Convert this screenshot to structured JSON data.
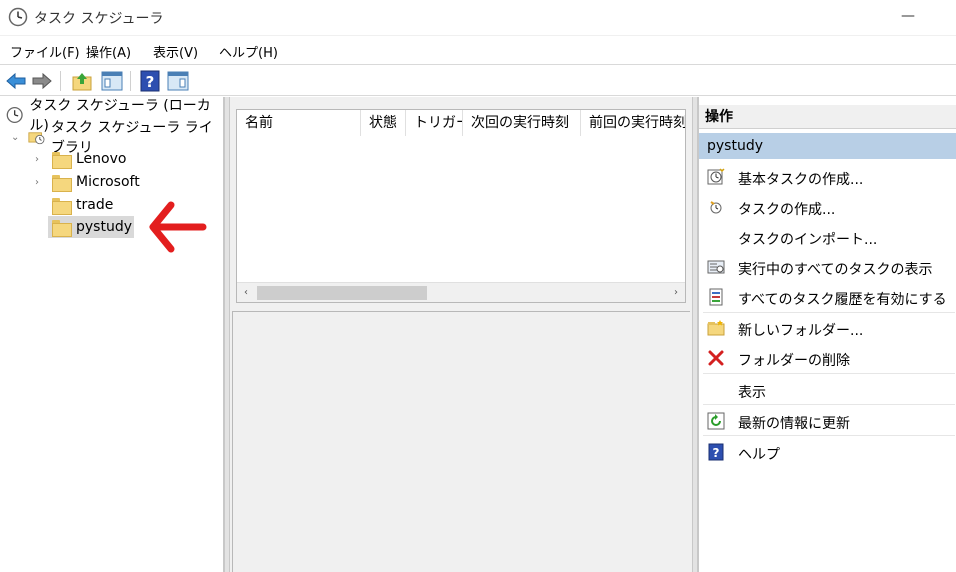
{
  "window": {
    "title": "タスク スケジューラ",
    "minimize_glyph": "—"
  },
  "menu": {
    "items": [
      "ファイル(F)",
      "操作(A)",
      "表示(V)",
      "ヘルプ(H)"
    ]
  },
  "toolbar": {
    "buttons": [
      "back-arrow-icon",
      "forward-arrow-icon",
      "folder-up-icon",
      "console-tree-icon",
      "help-icon",
      "action-pane-icon"
    ]
  },
  "tree": {
    "root": "タスク スケジューラ (ローカル)",
    "library": "タスク スケジューラ ライブラリ",
    "folders": [
      "Lenovo",
      "Microsoft",
      "trade",
      "pystudy"
    ],
    "selected": "pystudy"
  },
  "task_list": {
    "columns": [
      "名前",
      "状態",
      "トリガー",
      "次回の実行時刻",
      "前回の実行時刻"
    ]
  },
  "actions": {
    "header": "操作",
    "section": "pystudy",
    "items": [
      "基本タスクの作成...",
      "タスクの作成...",
      "タスクのインポート...",
      "実行中のすべてのタスクの表示",
      "すべてのタスク履歴を有効にする",
      "新しいフォルダー...",
      "フォルダーの削除",
      "表示",
      "最新の情報に更新",
      "ヘルプ"
    ]
  },
  "colors": {
    "selection_bg": "#d9d9d9",
    "section_bg": "#b8cfe6",
    "annotation": "#e31e1e"
  }
}
